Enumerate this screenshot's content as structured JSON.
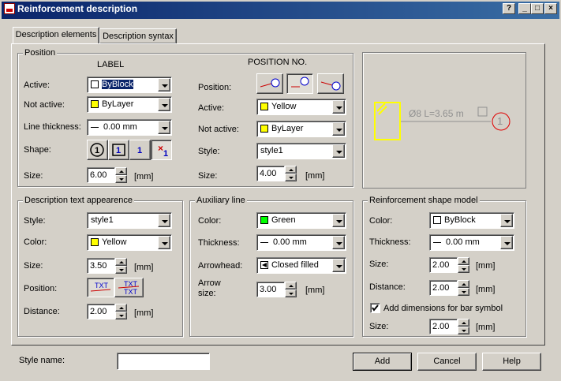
{
  "window": {
    "title": "Reinforcement description",
    "help": "?",
    "min": "_",
    "max": "□",
    "close": "×"
  },
  "tabs": [
    {
      "label": "Description elements"
    },
    {
      "label": "Description syntax"
    }
  ],
  "position": {
    "group": "Position",
    "label_header": "LABEL",
    "posno_header": "POSITION NO.",
    "active_label": "Active:",
    "active_value": "ByBlock",
    "notactive_label": "Not active:",
    "notactive_value": "ByLayer",
    "thickness_label": "Line thickness:",
    "thickness_value": "0.00 mm",
    "shape_label": "Shape:",
    "shape_options": [
      "1",
      "1",
      "1",
      "1"
    ],
    "size_label": "Size:",
    "size_value": "6.00",
    "size_unit": "[mm]",
    "pos_label": "Position:",
    "p_active_label": "Active:",
    "p_active_value": "Yellow",
    "p_notactive_label": "Not active:",
    "p_notactive_value": "ByLayer",
    "p_style_label": "Style:",
    "p_style_value": "style1",
    "p_size_label": "Size:",
    "p_size_value": "4.00",
    "p_size_unit": "[mm]"
  },
  "preview": {
    "text": "Ø8  L=3.65 m",
    "posno": "1"
  },
  "desc_text": {
    "group": "Description text appearence",
    "style_label": "Style:",
    "style_value": "style1",
    "color_label": "Color:",
    "color_value": "Yellow",
    "size_label": "Size:",
    "size_value": "3.50",
    "size_unit": "[mm]",
    "position_label": "Position:",
    "pos_txt": "TXT",
    "distance_label": "Distance:",
    "distance_value": "2.00",
    "distance_unit": "[mm]"
  },
  "aux_line": {
    "group": "Auxiliary line",
    "color_label": "Color:",
    "color_value": "Green",
    "thickness_label": "Thickness:",
    "thickness_value": "0.00 mm",
    "arrow_label": "Arrowhead:",
    "arrow_value": "Closed filled",
    "arrowsize_label1": "Arrow",
    "arrowsize_label2": "size:",
    "arrowsize_value": "3.00",
    "arrowsize_unit": "[mm]"
  },
  "shape_model": {
    "group": "Reinforcement shape model",
    "color_label": "Color:",
    "color_value": "ByBlock",
    "thickness_label": "Thickness:",
    "thickness_value": "0.00 mm",
    "size_label": "Size:",
    "size_value": "2.00",
    "size_unit": "[mm]",
    "distance_label": "Distance:",
    "distance_value": "2.00",
    "distance_unit": "[mm]",
    "add_dims_label": "Add dimensions for bar symbol",
    "size2_label": "Size:",
    "size2_value": "2.00",
    "size2_unit": "[mm]"
  },
  "footer": {
    "style_name_label": "Style name:",
    "style_name_value": "",
    "add": "Add",
    "cancel": "Cancel",
    "help": "Help"
  },
  "colors": {
    "yellow": "#ffff00",
    "green": "#00ff00",
    "white": "#ffffff",
    "titlebar": "#0a246a"
  }
}
